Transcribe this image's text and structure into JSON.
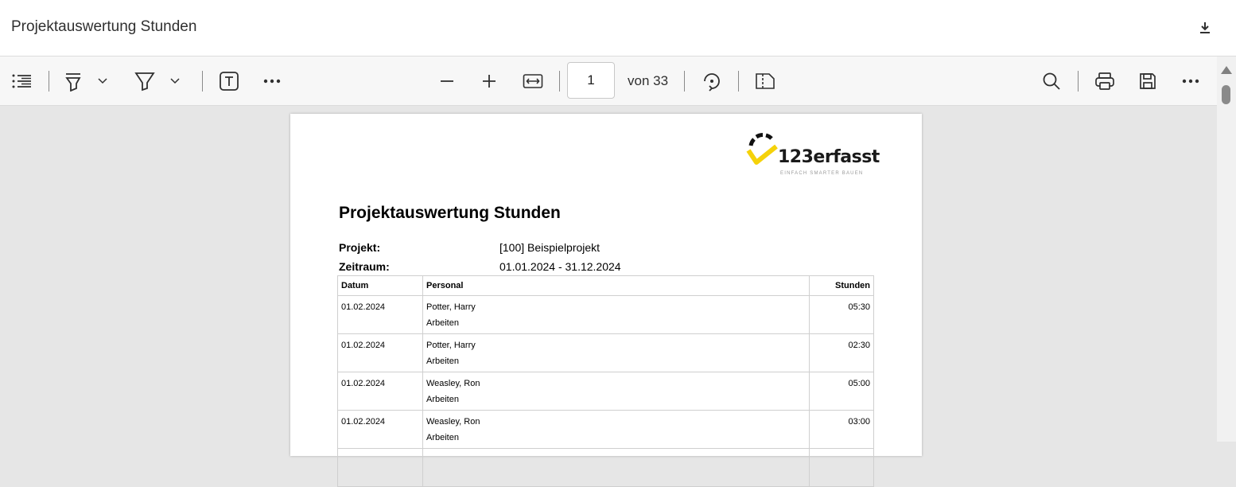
{
  "window": {
    "title": "Projektauswertung Stunden",
    "download_icon": "download-icon"
  },
  "toolbar": {
    "icons": [
      "toc-icon",
      "highlight-icon",
      "draw-icon",
      "text-box-icon",
      "more-icon",
      "zoom-out-icon",
      "zoom-in-icon",
      "fit-width-icon",
      "rotate-icon",
      "page-view-icon",
      "search-icon",
      "print-icon",
      "save-icon",
      "more-icon"
    ],
    "page_number": "1",
    "page_total": "von 33"
  },
  "document": {
    "logo": {
      "brand": "123erfasst",
      "tagline": "EINFACH SMARTER BAUEN",
      "accent_color": "#f5d20a"
    },
    "title": "Projektauswertung Stunden",
    "meta": [
      {
        "label": "Projekt:",
        "value": "[100] Beispielprojekt"
      },
      {
        "label": "Zeitraum:",
        "value": "01.01.2024 - 31.12.2024"
      }
    ],
    "table": {
      "headers": {
        "date": "Datum",
        "person": "Personal",
        "hours": "Stunden"
      },
      "rows": [
        {
          "date": "01.02.2024",
          "person": "Potter, Harry",
          "activity": "Arbeiten",
          "hours": "05:30"
        },
        {
          "date": "01.02.2024",
          "person": "Potter, Harry",
          "activity": "Arbeiten",
          "hours": "02:30"
        },
        {
          "date": "01.02.2024",
          "person": "Weasley, Ron",
          "activity": "Arbeiten",
          "hours": "05:00"
        },
        {
          "date": "01.02.2024",
          "person": "Weasley, Ron",
          "activity": "Arbeiten",
          "hours": "03:00"
        }
      ]
    }
  }
}
